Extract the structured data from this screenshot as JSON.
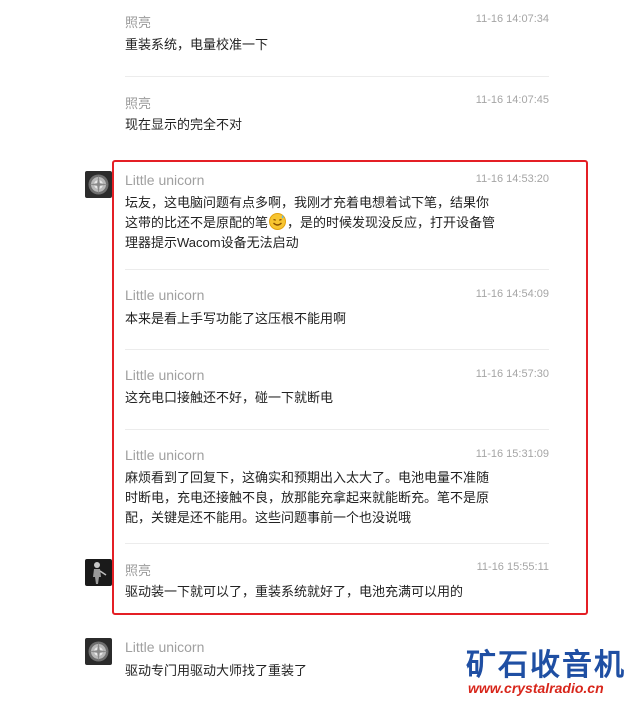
{
  "posts": [
    {
      "author": "照亮",
      "time": "11-16 14:07:34",
      "lines": [
        "重装系统，电量校准一下"
      ]
    },
    {
      "author": "照亮",
      "time": "11-16 14:07:45",
      "lines": [
        "现在显示的完全不对"
      ]
    },
    {
      "author": "Little unicorn",
      "avatar_icon": "unicorn-avatar-icon",
      "time": "11-16 14:53:20",
      "lines": [
        "坛友，这电脑问题有点多啊，我刚才充着电想着试下笔，结果你",
        "这带的比还不是原配的笔",
        "，是的时候发现没反应，打开设备管",
        "理器提示Wacom设备无法启动"
      ]
    },
    {
      "author": "Little unicorn",
      "time": "11-16 14:54:09",
      "lines": [
        "本来是看上手写功能了这压根不能用啊"
      ]
    },
    {
      "author": "Little unicorn",
      "time": "11-16 14:57:30",
      "lines": [
        "这充电口接触还不好，碰一下就断电"
      ]
    },
    {
      "author": "Little unicorn",
      "time": "11-16 15:31:09",
      "lines": [
        "麻烦看到了回复下，这确实和预期出入太大了。电池电量不准随",
        "时断电，充电还接触不良，放那能充拿起来就能断充。笔不是原",
        "配，关键是还不能用。这些问题事前一个也没说哦"
      ]
    },
    {
      "author": "照亮",
      "avatar_icon": "person-avatar-icon",
      "time": "11-16 15:55:11",
      "lines": [
        "驱动装一下就可以了，重装系统就好了，电池充满可以用的"
      ]
    },
    {
      "author": "Little unicorn",
      "avatar_icon": "unicorn-avatar-icon",
      "time": "",
      "lines": [
        "驱动专门用驱动大师找了重装了"
      ]
    }
  ],
  "emoji_icon": "sweat-smile-emoji-icon",
  "highlight_color": "#e41f25",
  "watermark": {
    "title": "矿石收音机",
    "url": "www.crystalradio.cn"
  }
}
